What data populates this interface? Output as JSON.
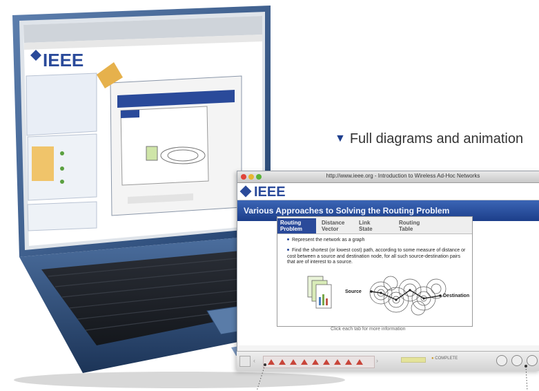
{
  "caption": "Full diagrams and animation",
  "window": {
    "title": "http://www.ieee.org - Introduction to Wireless Ad-Hoc Networks",
    "logo": "IEEE",
    "banner": "Various Approaches to Solving the Routing Problem"
  },
  "tabs": [
    {
      "label_line1": "Routing",
      "label_line2": "Problem",
      "active": true
    },
    {
      "label_line1": "Distance",
      "label_line2": "Vector",
      "active": false
    },
    {
      "label_line1": "Link",
      "label_line2": "State",
      "active": false
    },
    {
      "label_line1": "Routing",
      "label_line2": "Table",
      "active": false
    }
  ],
  "bullets": [
    "Represent the network as a graph",
    "Find the shortest (or lowest cost) path, according to some measure of distance or cost between a source and destination node, for all such source-destination pairs that are of interest to a source."
  ],
  "diagram": {
    "source_label": "Source",
    "destination_label": "Destination"
  },
  "hint": "Click each tab for more information",
  "controls": {
    "complete": "COMPLETE"
  },
  "background_laptop": {
    "logo": "IEEE"
  },
  "colors": {
    "brand_blue": "#2a4a9a",
    "banner_blue": "#1c3e8a",
    "laptop_blue": "#3a5f8f"
  }
}
